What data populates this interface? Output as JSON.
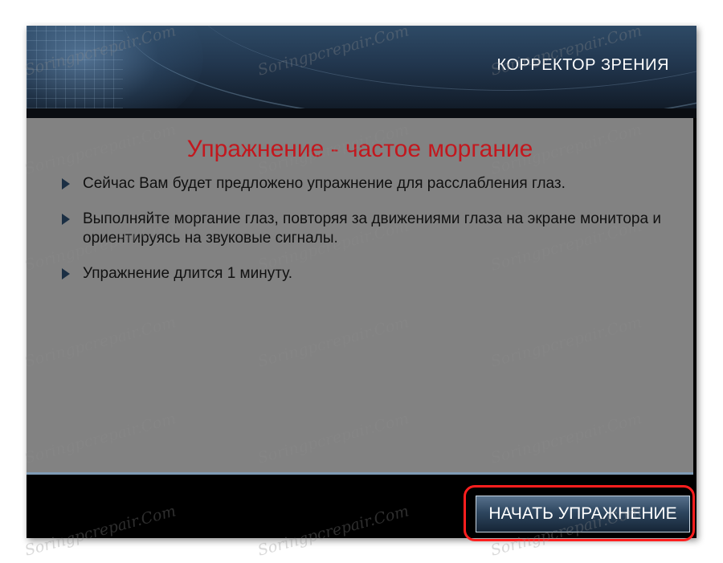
{
  "header": {
    "title": "КОРРЕКТОР ЗРЕНИЯ"
  },
  "exercise": {
    "title": "Упражнение - частое моргание",
    "instructions": [
      "Сейчас Вам будет предложено упражнение для расслабления глаз.",
      "Выполняйте моргание глаз, повторяя за движениями глаза на экране монитора и ориентируясь на звуковые сигналы.",
      "Упражнение длится 1 минуту."
    ]
  },
  "footer": {
    "start_button_label": "НАЧАТЬ УПРАЖНЕНИЕ"
  },
  "watermark": {
    "text": "Soringpcrepair.Com"
  },
  "colors": {
    "title_red": "#c2181e",
    "content_gray": "#828282",
    "highlight_red": "#ff1e1e",
    "header_blue": "#22374f"
  }
}
